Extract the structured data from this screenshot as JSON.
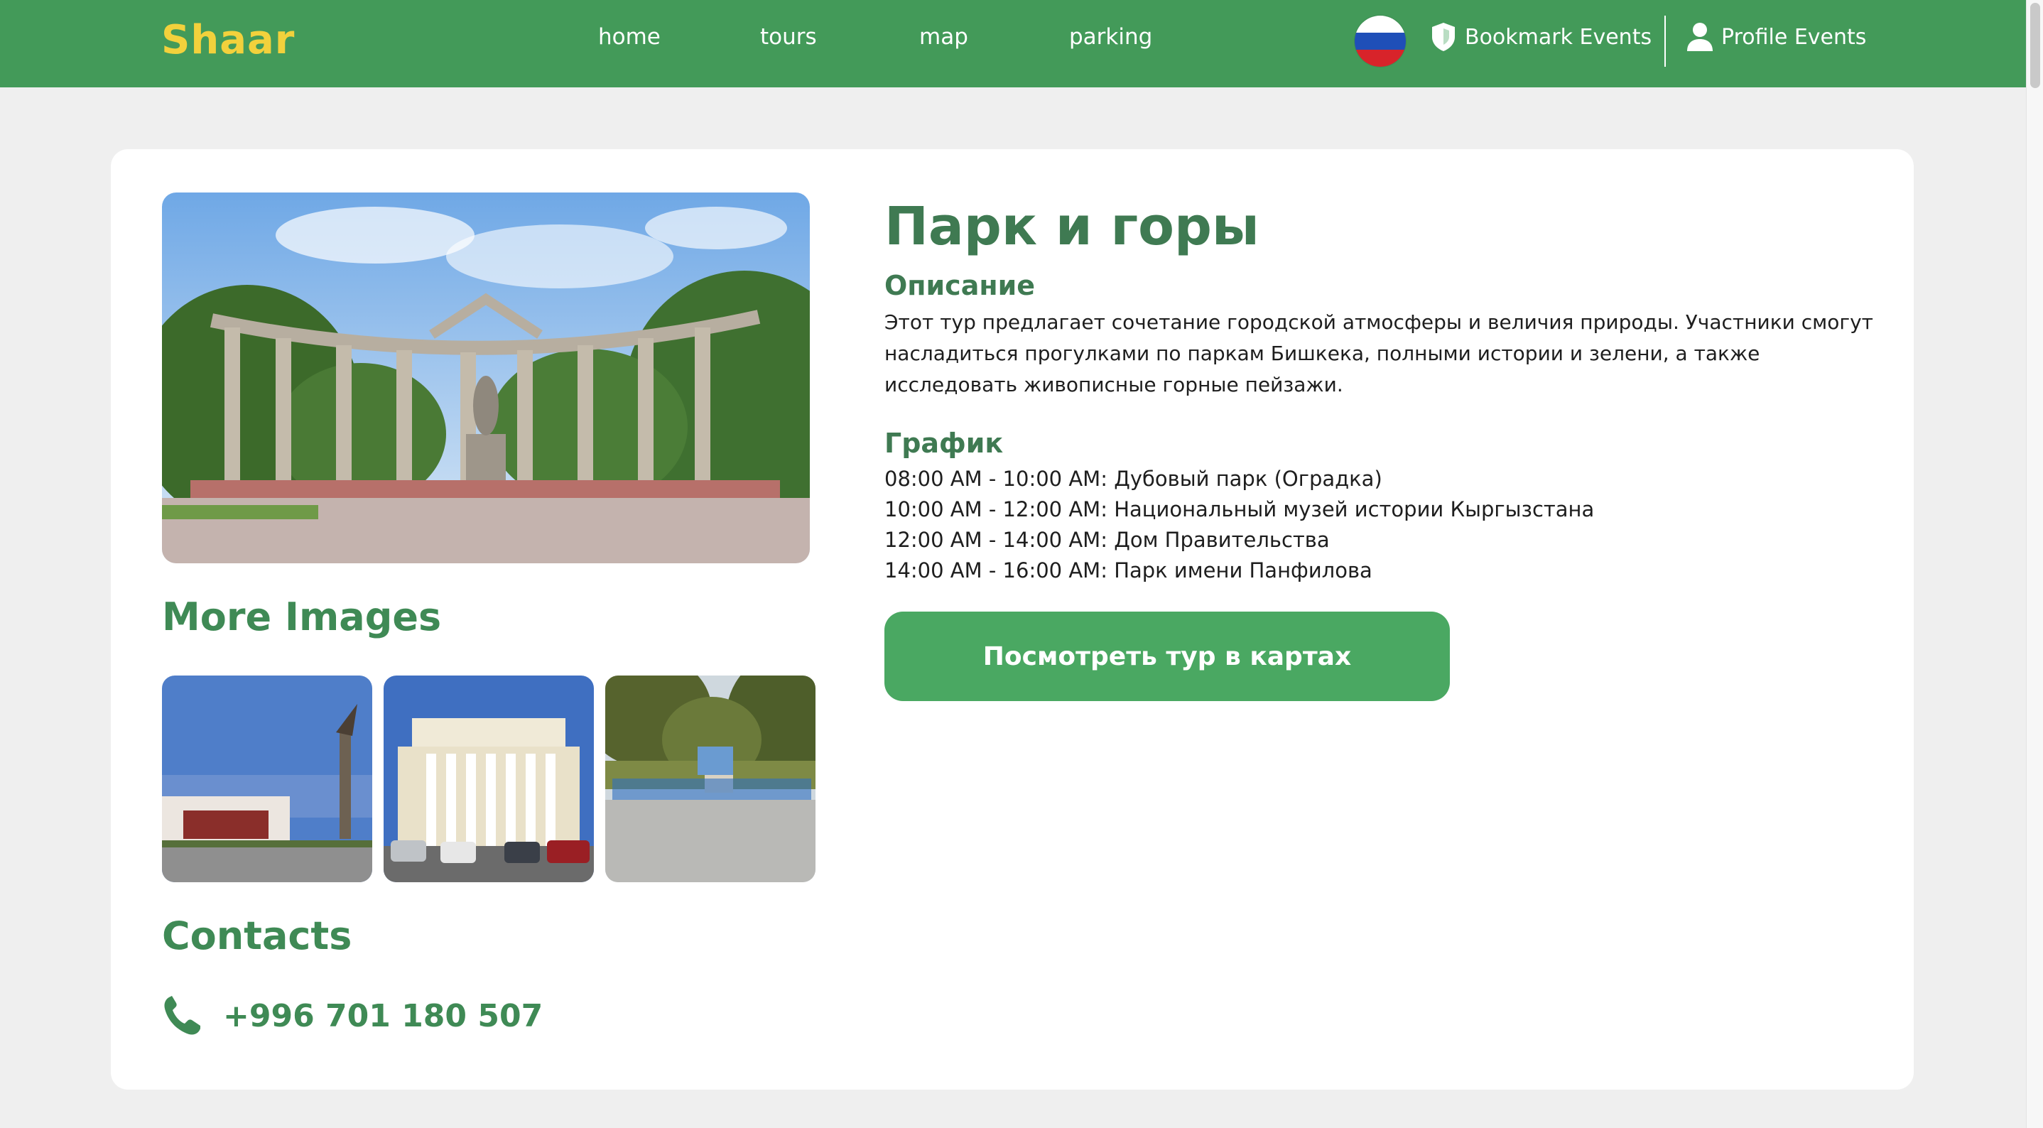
{
  "header": {
    "logo": "Shaar",
    "nav": [
      "home",
      "tours",
      "map",
      "parking"
    ],
    "language_flag": "russia-flag",
    "bookmark_label": "Bookmark Events",
    "profile_label": "Profile Events"
  },
  "left": {
    "more_images_heading": "More Images",
    "contacts_heading": "Contacts",
    "phone": "+996 701 180 507"
  },
  "tour": {
    "title": "Парк и горы",
    "description_heading": "Описание",
    "description": "Этот тур предлагает сочетание городской атмосферы и величия природы. Участники смогут насладиться прогулками по паркам Бишкека, полными истории и зелени, а также исследовать живописные горные пейзажи.",
    "schedule_heading": "График",
    "schedule": [
      "08:00 AM - 10:00 AM: Дубовый парк (Оградка)",
      "10:00 AM - 12:00 AM: Национальный музей истории Кыргызстана",
      "12:00 AM - 14:00 AM: Дом Правительства",
      "14:00 AM - 16:00 AM: Парк имени Панфилова"
    ],
    "map_button": "Посмотреть тур в картах"
  },
  "colors": {
    "header_bg": "#439a59",
    "logo": "#f2d13c",
    "heading_green": "#3f8a55",
    "button_green": "#4aa862",
    "page_bg": "#efefef"
  }
}
